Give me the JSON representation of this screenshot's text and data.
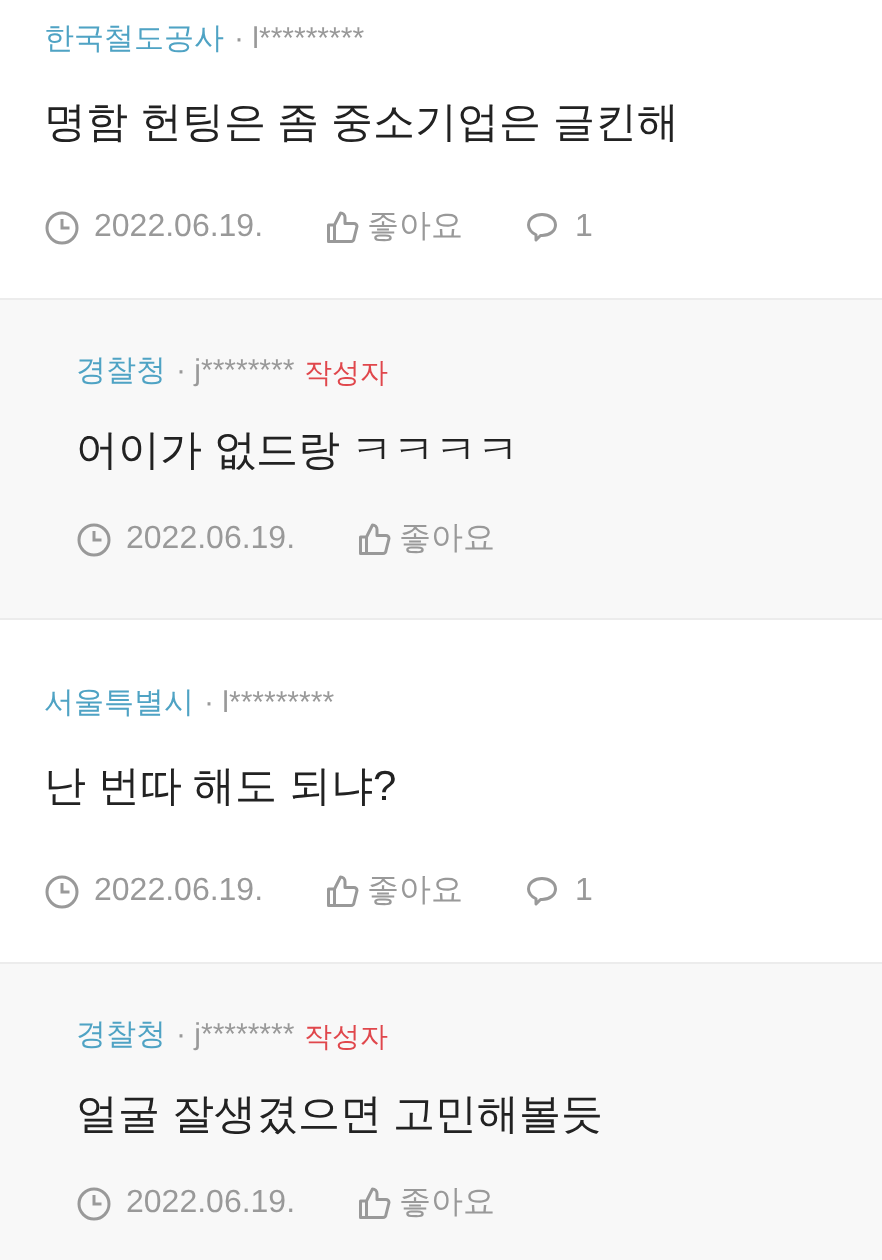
{
  "comments": [
    {
      "kind": "comment",
      "org": "한국철도공사",
      "user": "· l*********",
      "text": "명함 헌팅은 좀 중소기업은 글킨해",
      "date": "2022.06.19.",
      "like": "좋아요",
      "replies": "1"
    },
    {
      "kind": "reply",
      "org": "경찰청",
      "user": "· j********",
      "badge": "작성자",
      "text": "어이가 없드랑 ㅋㅋㅋㅋ",
      "date": "2022.06.19.",
      "like": "좋아요"
    },
    {
      "kind": "comment",
      "org": "서울특별시",
      "user": "· l*********",
      "text": "난 번따 해도 되냐?",
      "date": "2022.06.19.",
      "like": "좋아요",
      "replies": "1"
    },
    {
      "kind": "reply",
      "org": "경찰청",
      "user": "· j********",
      "badge": "작성자",
      "text": "얼굴 잘생겼으면 고민해볼듯",
      "date": "2022.06.19.",
      "like": "좋아요"
    }
  ]
}
